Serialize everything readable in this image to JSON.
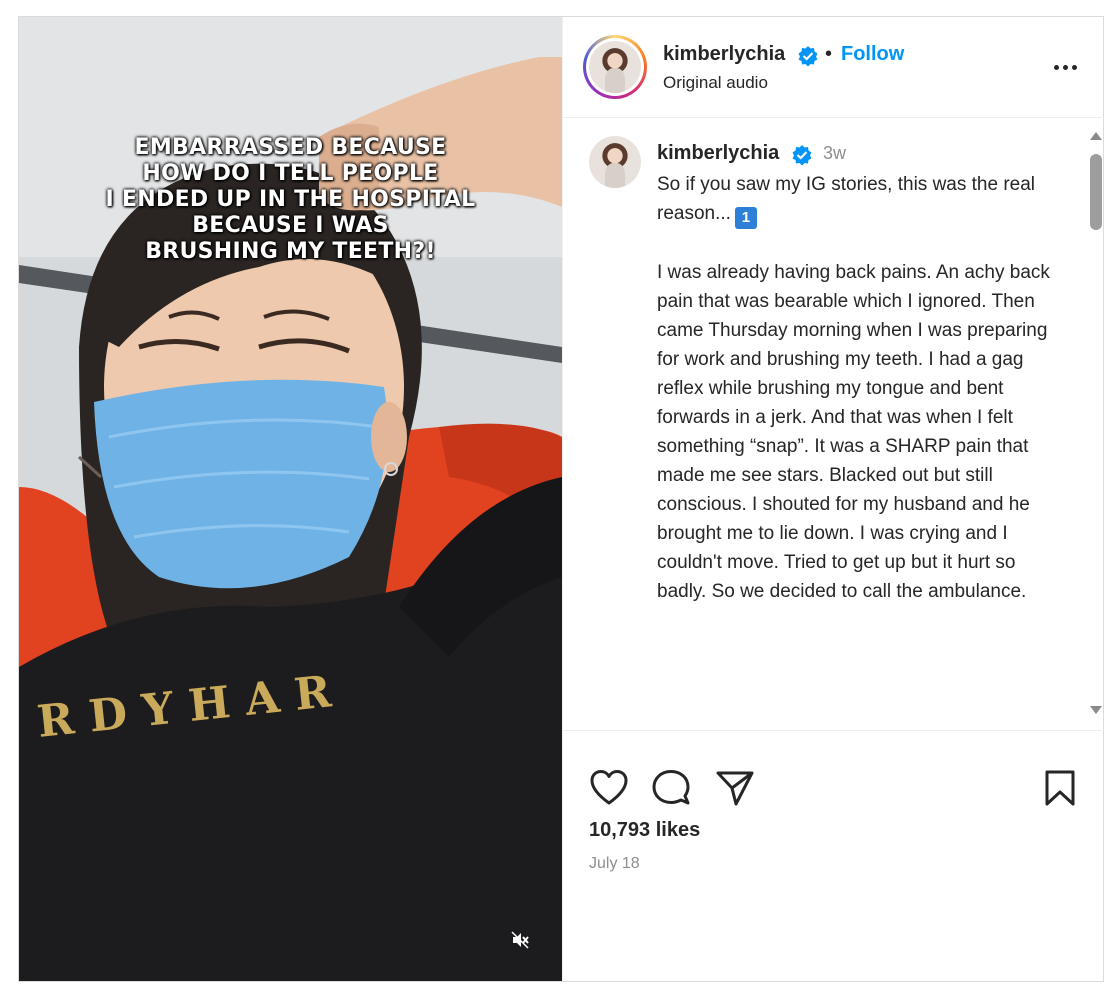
{
  "media": {
    "overlay_caption_lines": [
      "EMBARRASSED BECAUSE",
      "HOW DO I TELL PEOPLE",
      "I ENDED UP IN THE HOSPITAL",
      "BECAUSE I WAS",
      "BRUSHING MY TEETH?!"
    ],
    "shirt_text": "RDY HAR",
    "muted": true
  },
  "header": {
    "username": "kimberlychia",
    "separator": "•",
    "follow_label": "Follow",
    "subtitle": "Original audio"
  },
  "caption": {
    "username": "kimberlychia",
    "time": "3w",
    "intro": "So if you saw my IG stories, this was the real reason...",
    "emoji": "1",
    "body": "I was already having back pains. An achy back pain that was bearable which I ignored. Then came Thursday morning when I was preparing for work and brushing my teeth. I had a gag reflex while brushing my tongue and bent forwards in a jerk. And that was when I felt something “snap”. It was a SHARP pain that made me see stars. Blacked out but still conscious. I shouted for my husband and he brought me to lie down. I was crying and I couldn't move. Tried to get up but it hurt so badly. So we decided to call the ambulance."
  },
  "actions": {
    "likes": "10,793 likes",
    "date": "July 18"
  },
  "colors": {
    "accent": "#0095f6",
    "verified": "#0095f6",
    "muted_text": "#8e8e8e",
    "mask": "#6fb3e6",
    "seat": "#e1421f",
    "shirt": "#1c1c1e"
  },
  "icons": [
    "heart-icon",
    "comment-icon",
    "share-icon",
    "bookmark-icon",
    "more-icon",
    "mute-icon",
    "verified-icon"
  ]
}
